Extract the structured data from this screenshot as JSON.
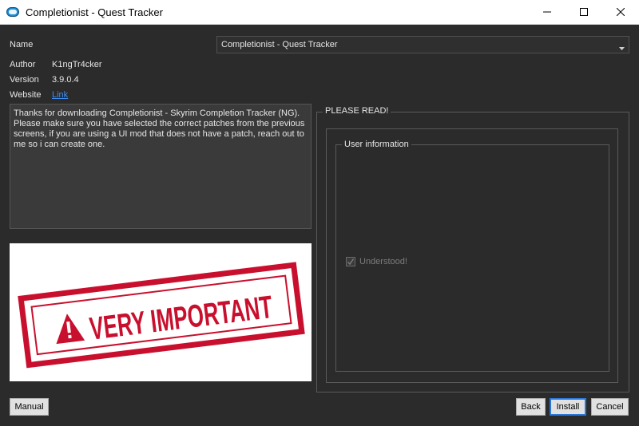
{
  "window": {
    "title": "Completionist - Quest Tracker",
    "icon": "app-icon",
    "controls": [
      "minimize-icon",
      "maximize-icon",
      "close-icon"
    ]
  },
  "form": {
    "name_label": "Name",
    "name_value": "Completionist - Quest Tracker",
    "author_label": "Author",
    "author_value": "K1ngTr4cker",
    "version_label": "Version",
    "version_value": "3.9.0.4",
    "website_label": "Website",
    "website_link": "Link"
  },
  "description": "Thanks for downloading Completionist - Skyrim Completion Tracker (NG). Please make sure you have selected the correct patches from the previous screens, if you are using a UI mod that does not have a patch, reach out to me so i can create one.",
  "banner": {
    "text": "VERY IMPORTANT",
    "color": "#c8102e"
  },
  "please_read": {
    "title": "PLEASE READ!",
    "group_title": "User information",
    "checkbox_label": "Understood!",
    "checked": true
  },
  "buttons": {
    "manual": "Manual",
    "back": "Back",
    "install": "Install",
    "cancel": "Cancel"
  }
}
